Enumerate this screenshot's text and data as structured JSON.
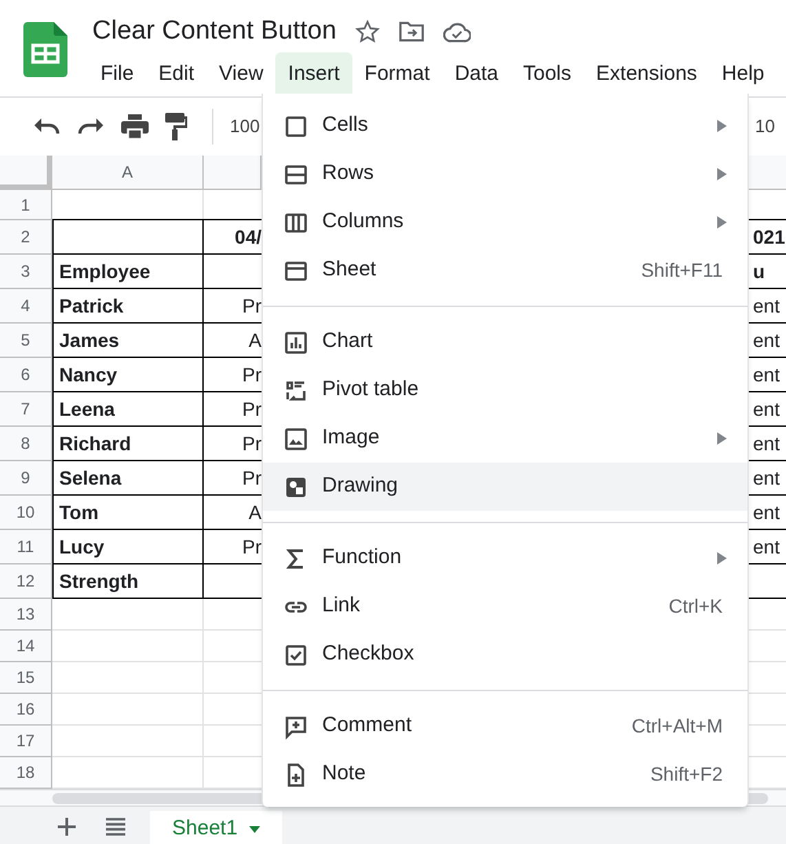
{
  "document": {
    "title": "Clear Content Button"
  },
  "menu_bar": [
    {
      "label": "File",
      "selected": false
    },
    {
      "label": "Edit",
      "selected": false
    },
    {
      "label": "View",
      "selected": false
    },
    {
      "label": "Insert",
      "selected": true
    },
    {
      "label": "Format",
      "selected": false
    },
    {
      "label": "Data",
      "selected": false
    },
    {
      "label": "Tools",
      "selected": false
    },
    {
      "label": "Extensions",
      "selected": false
    },
    {
      "label": "Help",
      "selected": false
    }
  ],
  "toolbar": {
    "zoom": "100",
    "font_size": "10"
  },
  "sheet": {
    "column_headers": [
      "A"
    ],
    "rows": [
      {
        "number": "1",
        "bordered": false
      },
      {
        "number": "2",
        "bordered": true,
        "header": true,
        "column_b": "04/",
        "column_3": "021"
      },
      {
        "number": "3",
        "bordered": true,
        "header": true,
        "column_a": "Employee",
        "column_3": "u"
      },
      {
        "number": "4",
        "bordered": true,
        "header": false,
        "column_a": "Patrick",
        "column_b": "Pr",
        "column_3": "ent"
      },
      {
        "number": "5",
        "bordered": true,
        "header": false,
        "column_a": "James",
        "column_b": "A",
        "column_3": "ent"
      },
      {
        "number": "6",
        "bordered": true,
        "header": false,
        "column_a": "Nancy",
        "column_b": "Pr",
        "column_3": "ent"
      },
      {
        "number": "7",
        "bordered": true,
        "header": false,
        "column_a": "Leena",
        "column_b": "Pr",
        "column_3": "ent"
      },
      {
        "number": "8",
        "bordered": true,
        "header": false,
        "column_a": "Richard",
        "column_b": "Pr",
        "column_3": "ent"
      },
      {
        "number": "9",
        "bordered": true,
        "header": false,
        "column_a": "Selena",
        "column_b": "Pr",
        "column_3": "ent"
      },
      {
        "number": "10",
        "bordered": true,
        "header": false,
        "column_a": "Tom",
        "column_b": "A",
        "column_3": "ent"
      },
      {
        "number": "11",
        "bordered": true,
        "header": false,
        "column_a": "Lucy",
        "column_b": "Pr",
        "column_3": "ent"
      },
      {
        "number": "12",
        "bordered": true,
        "column_a": "Strength"
      },
      {
        "number": "13",
        "bordered": false
      },
      {
        "number": "14",
        "bordered": false
      },
      {
        "number": "15",
        "bordered": false
      },
      {
        "number": "16",
        "bordered": false
      },
      {
        "number": "17",
        "bordered": false
      },
      {
        "number": "18",
        "bordered": false
      }
    ]
  },
  "sheet_tabs": [
    {
      "label": "Sheet1",
      "selected": true
    }
  ],
  "insert_menu": {
    "sections": [
      [
        {
          "label": "Cells",
          "submenu": true,
          "highlighted": false
        },
        {
          "label": "Rows",
          "submenu": true,
          "highlighted": false
        },
        {
          "label": "Columns",
          "submenu": true,
          "highlighted": false
        },
        {
          "label": "Sheet",
          "shortcut": "Shift+F11",
          "submenu": false,
          "highlighted": false
        }
      ],
      [
        {
          "label": "Chart",
          "submenu": false,
          "highlighted": false
        },
        {
          "label": "Pivot table",
          "submenu": false,
          "highlighted": false
        },
        {
          "label": "Image",
          "submenu": true,
          "highlighted": false
        },
        {
          "label": "Drawing",
          "submenu": false,
          "highlighted": true
        }
      ],
      [
        {
          "label": "Function",
          "submenu": true,
          "highlighted": false
        },
        {
          "label": "Link",
          "shortcut": "Ctrl+K",
          "submenu": false,
          "highlighted": false
        },
        {
          "label": "Checkbox",
          "submenu": false,
          "highlighted": false
        }
      ],
      [
        {
          "label": "Comment",
          "shortcut": "Ctrl+Alt+M",
          "submenu": false,
          "highlighted": false
        },
        {
          "label": "Note",
          "shortcut": "Shift+F2",
          "submenu": false,
          "highlighted": false
        }
      ]
    ]
  }
}
